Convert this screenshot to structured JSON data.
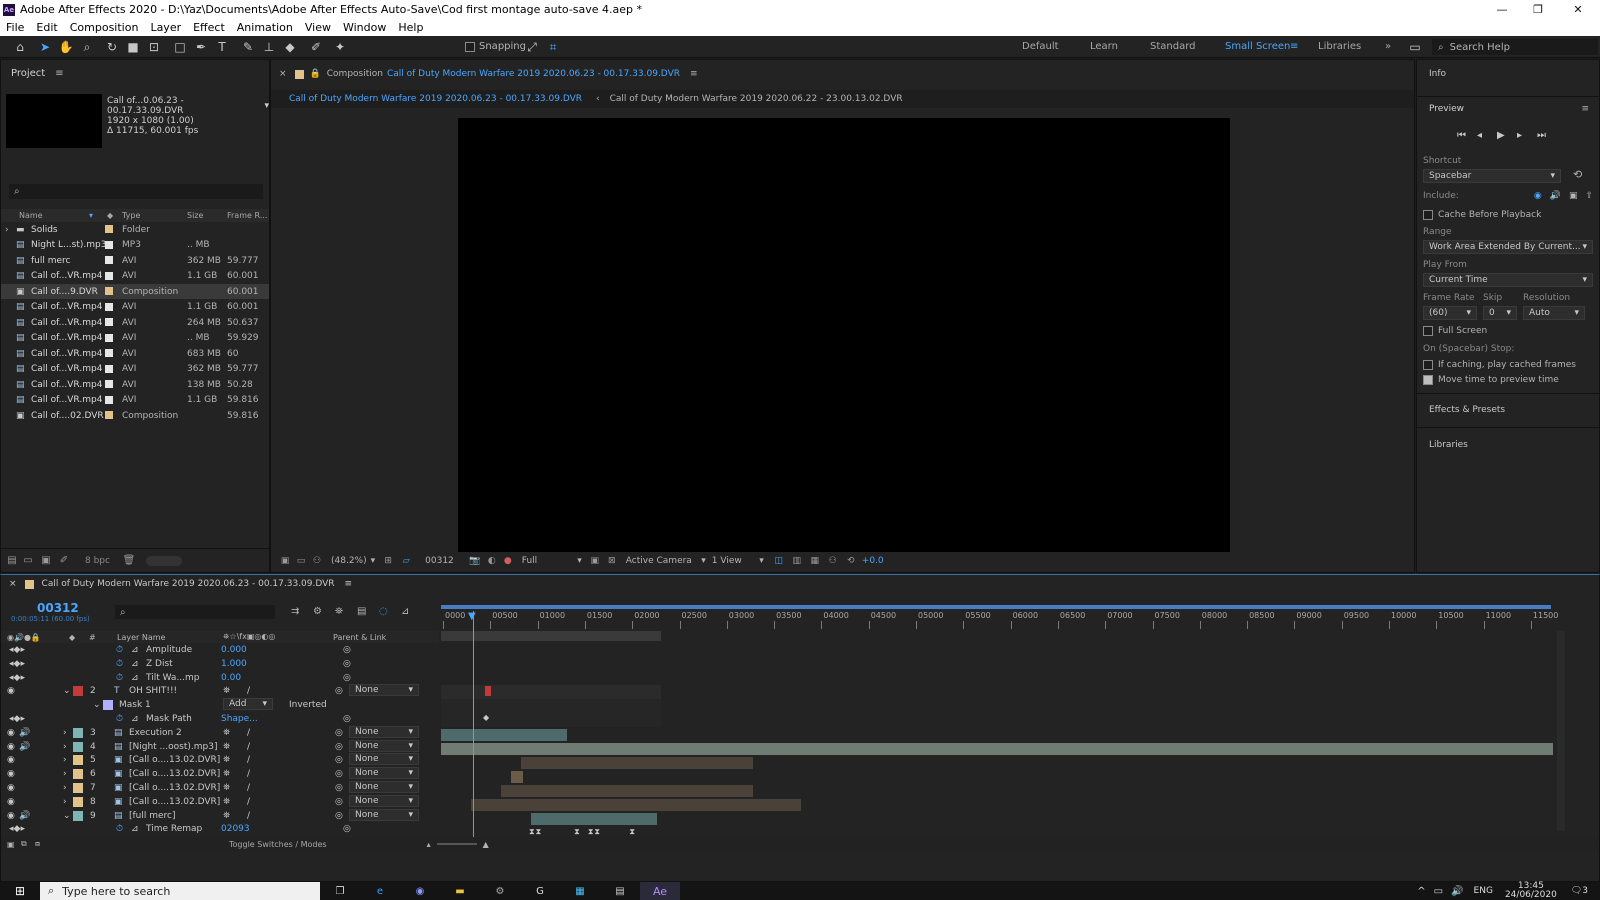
{
  "titlebar": {
    "title": "Adobe After Effects 2020 - D:\\Yaz\\Documents\\Adobe After Effects Auto-Save\\Cod first montage auto-save 4.aep *",
    "logo": "Ae"
  },
  "menu": [
    "File",
    "Edit",
    "Composition",
    "Layer",
    "Effect",
    "Animation",
    "View",
    "Window",
    "Help"
  ],
  "toolbar": {
    "snapping": "Snapping",
    "workspaces": [
      "Default",
      "Learn",
      "Standard",
      "Small Screen",
      "Libraries"
    ],
    "search_placeholder": "Search Help"
  },
  "project": {
    "title": "Project",
    "item_name": "Call of...0.06.23 - 00.17.33.09.DVR",
    "item_res": "1920 x 1080 (1.00)",
    "item_dur": "Δ 11715, 60.001 fps",
    "columns": [
      "Name",
      "Type",
      "Size",
      "Frame R..."
    ],
    "rows": [
      {
        "name": "Solids",
        "type": "Folder",
        "size": "",
        "fr": "",
        "icon": "folder"
      },
      {
        "name": "Night L...st).mp3",
        "type": "MP3",
        "size": ".. MB",
        "fr": "",
        "icon": "file"
      },
      {
        "name": "full merc",
        "type": "AVI",
        "size": "362 MB",
        "fr": "59.777",
        "icon": "file"
      },
      {
        "name": "Call of...VR.mp4",
        "type": "AVI",
        "size": "1.1 GB",
        "fr": "60.001",
        "icon": "file"
      },
      {
        "name": "Call of....9.DVR",
        "type": "Composition",
        "size": "",
        "fr": "60.001",
        "icon": "comp"
      },
      {
        "name": "Call of...VR.mp4",
        "type": "AVI",
        "size": "1.1 GB",
        "fr": "60.001",
        "icon": "file"
      },
      {
        "name": "Call of...VR.mp4",
        "type": "AVI",
        "size": "264 MB",
        "fr": "50.637",
        "icon": "file"
      },
      {
        "name": "Call of...VR.mp4",
        "type": "AVI",
        "size": ".. MB",
        "fr": "59.929",
        "icon": "file"
      },
      {
        "name": "Call of...VR.mp4",
        "type": "AVI",
        "size": "683 MB",
        "fr": "60",
        "icon": "file"
      },
      {
        "name": "Call of...VR.mp4",
        "type": "AVI",
        "size": "362 MB",
        "fr": "59.777",
        "icon": "file"
      },
      {
        "name": "Call of...VR.mp4",
        "type": "AVI",
        "size": "138 MB",
        "fr": "50.28",
        "icon": "file"
      },
      {
        "name": "Call of...VR.mp4",
        "type": "AVI",
        "size": "1.1 GB",
        "fr": "59.816",
        "icon": "file"
      },
      {
        "name": "Call of....02.DVR",
        "type": "Composition",
        "size": "",
        "fr": "59.816",
        "icon": "comp"
      }
    ],
    "bpc": "8 bpc"
  },
  "comp": {
    "prefix": "Composition",
    "name": "Call of Duty  Modern Warfare 2019 2020.06.23 - 00.17.33.09.DVR",
    "tab1": "Call of Duty  Modern Warfare 2019 2020.06.23 - 00.17.33.09.DVR",
    "tab2": "Call of Duty  Modern Warfare 2019 2020.06.22 - 23.00.13.02.DVR",
    "zoom": "(48.2%)",
    "timecode": "00312",
    "resolution": "Full",
    "camera": "Active Camera",
    "views": "1 View",
    "exposure": "+0.0"
  },
  "right": {
    "info": "Info",
    "preview": "Preview",
    "shortcut_label": "Shortcut",
    "shortcut": "Spacebar",
    "include": "Include:",
    "cache": "Cache Before Playback",
    "range_label": "Range",
    "range": "Work Area Extended By Current...",
    "playfrom_label": "Play From",
    "playfrom": "Current Time",
    "fr_label": "Frame Rate",
    "skip_label": "Skip",
    "res_label": "Resolution",
    "fr": "(60)",
    "skip": "0",
    "res": "Auto",
    "fullscreen": "Full Screen",
    "stop_label": "On (Spacebar) Stop:",
    "stop1": "If caching, play cached frames",
    "stop2": "Move time to preview time",
    "effects": "Effects & Presets",
    "libraries": "Libraries"
  },
  "timeline": {
    "title": "Call of Duty  Modern Warfare 2019 2020.06.23 - 00.17.33.09.DVR",
    "timecode": "00312",
    "timecode_sub": "0:00:05:11 (60.00 fps)",
    "col_layer": "Layer Name",
    "col_parent": "Parent & Link",
    "ruler": [
      "0000",
      "00500",
      "01000",
      "01500",
      "02000",
      "02500",
      "03000",
      "03500",
      "04000",
      "04500",
      "05000",
      "05500",
      "06000",
      "06500",
      "07000",
      "07500",
      "08000",
      "08500",
      "09000",
      "09500",
      "10000",
      "10500",
      "11000",
      "11500"
    ],
    "toggle": "Toggle Switches / Modes",
    "rows": [
      {
        "num": "",
        "name": "Amplitude",
        "value": "0.000",
        "kind": "prop"
      },
      {
        "num": "",
        "name": "Z Dist",
        "value": "1.000",
        "kind": "prop"
      },
      {
        "num": "",
        "name": "Tilt Wa...mp",
        "value": "0.00",
        "kind": "prop"
      },
      {
        "num": "2",
        "name": "OH SHIT!!!",
        "value": "",
        "kind": "layer",
        "parent": "None",
        "color": "#c23b3b",
        "icon": "T"
      },
      {
        "num": "",
        "name": "Mask 1",
        "value": "",
        "kind": "mask",
        "mode": "Add",
        "inv": "Inverted"
      },
      {
        "num": "",
        "name": "Mask Path",
        "value": "Shape...",
        "kind": "prop"
      },
      {
        "num": "3",
        "name": "Execution 2",
        "value": "",
        "kind": "layer",
        "parent": "None",
        "color": "#7fb5b5",
        "icon": "f"
      },
      {
        "num": "4",
        "name": "[Night ...oost).mp3]",
        "value": "",
        "kind": "layer",
        "parent": "None",
        "color": "#7fb5b5",
        "icon": "f"
      },
      {
        "num": "5",
        "name": "[Call o....13.02.DVR]",
        "value": "",
        "kind": "layer",
        "parent": "None",
        "color": "#e0c28a",
        "icon": "c"
      },
      {
        "num": "6",
        "name": "[Call o....13.02.DVR]",
        "value": "",
        "kind": "layer",
        "parent": "None",
        "color": "#e0c28a",
        "icon": "c"
      },
      {
        "num": "7",
        "name": "[Call o....13.02.DVR]",
        "value": "",
        "kind": "layer",
        "parent": "None",
        "color": "#e0c28a",
        "icon": "c"
      },
      {
        "num": "8",
        "name": "[Call o....13.02.DVR]",
        "value": "",
        "kind": "layer",
        "parent": "None",
        "color": "#e0c28a",
        "icon": "c"
      },
      {
        "num": "9",
        "name": "[full merc]",
        "value": "",
        "kind": "layer",
        "parent": "None",
        "color": "#7fb5b5",
        "icon": "f"
      },
      {
        "num": "",
        "name": "Time Remap",
        "value": "02093",
        "kind": "prop"
      }
    ]
  },
  "taskbar": {
    "search": "Type here to search",
    "lang": "ENG",
    "time": "13:45",
    "date": "24/06/2020",
    "notif": "3"
  }
}
